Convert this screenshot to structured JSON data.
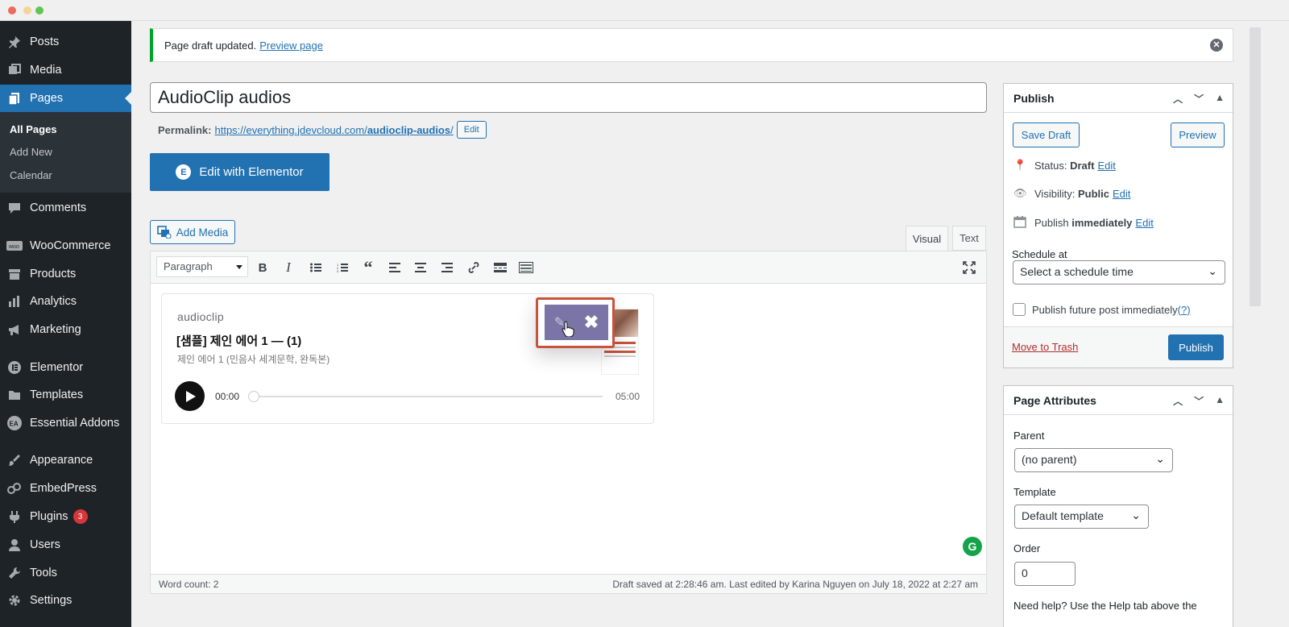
{
  "sidebar": {
    "items": [
      {
        "label": "Posts",
        "icon": "pin-icon"
      },
      {
        "label": "Media",
        "icon": "media-icon"
      },
      {
        "label": "Pages",
        "icon": "pages-icon"
      },
      {
        "label": "Comments",
        "icon": "comment-icon"
      },
      {
        "label": "WooCommerce",
        "icon": "woo-icon"
      },
      {
        "label": "Products",
        "icon": "archive-icon"
      },
      {
        "label": "Analytics",
        "icon": "bar-chart-icon"
      },
      {
        "label": "Marketing",
        "icon": "megaphone-icon"
      },
      {
        "label": "Elementor",
        "icon": "elementor-icon"
      },
      {
        "label": "Templates",
        "icon": "folder-icon"
      },
      {
        "label": "Essential Addons",
        "icon": "ea-icon"
      },
      {
        "label": "Appearance",
        "icon": "brush-icon"
      },
      {
        "label": "EmbedPress",
        "icon": "embed-icon"
      },
      {
        "label": "Plugins",
        "icon": "plug-icon",
        "badge": "3"
      },
      {
        "label": "Users",
        "icon": "user-icon"
      },
      {
        "label": "Tools",
        "icon": "wrench-icon"
      },
      {
        "label": "Settings",
        "icon": "gear-icon"
      }
    ],
    "submenu": [
      "All Pages",
      "Add New",
      "Calendar"
    ]
  },
  "notice": {
    "text": "Page draft updated.",
    "link": "Preview page"
  },
  "post": {
    "title": "AudioClip audios",
    "permalink_label": "Permalink:",
    "permalink_base": "https://everything.jdevcloud.com/",
    "permalink_slug": "audioclip-audios",
    "permalink_end": "/",
    "edit_label": "Edit"
  },
  "elementor_btn": "Edit with Elementor",
  "add_media": "Add Media",
  "tabs": {
    "visual": "Visual",
    "text": "Text"
  },
  "toolbar": {
    "format": "Paragraph"
  },
  "audioclip": {
    "brand": "audioclip",
    "title": "[샘플] 제인 에어 1 — (1)",
    "subtitle": "제인 에어 1 (민음사 세계문학, 완독본)",
    "time_start": "00:00",
    "time_end": "05:00",
    "progress": 0
  },
  "editor_footer": {
    "word_count": "Word count: 2",
    "saved": "Draft saved at 2:28:46 am. Last edited by Karina Nguyen on July 18, 2022 at 2:27 am"
  },
  "publish": {
    "title": "Publish",
    "save_draft": "Save Draft",
    "preview": "Preview",
    "status_label": "Status:",
    "status_value": "Draft",
    "visibility_label": "Visibility:",
    "visibility_value": "Public",
    "publish_label": "Publish",
    "publish_value": "immediately",
    "edit": "Edit",
    "schedule_label": "Schedule at",
    "schedule_placeholder": "Select a schedule time",
    "future_label": "Publish future post immediately",
    "help_mark": "(?)",
    "trash": "Move to Trash",
    "publish_btn": "Publish"
  },
  "attributes": {
    "title": "Page Attributes",
    "parent_label": "Parent",
    "parent_value": "(no parent)",
    "template_label": "Template",
    "template_value": "Default template",
    "order_label": "Order",
    "order_value": "0",
    "help": "Need help? Use the Help tab above the"
  },
  "colors": {
    "accent": "#2271b1",
    "sidebar": "#1d2327",
    "notice_success": "#00a32a",
    "highlight": "#c8533a",
    "audio_overlay": "#7b74a6"
  }
}
